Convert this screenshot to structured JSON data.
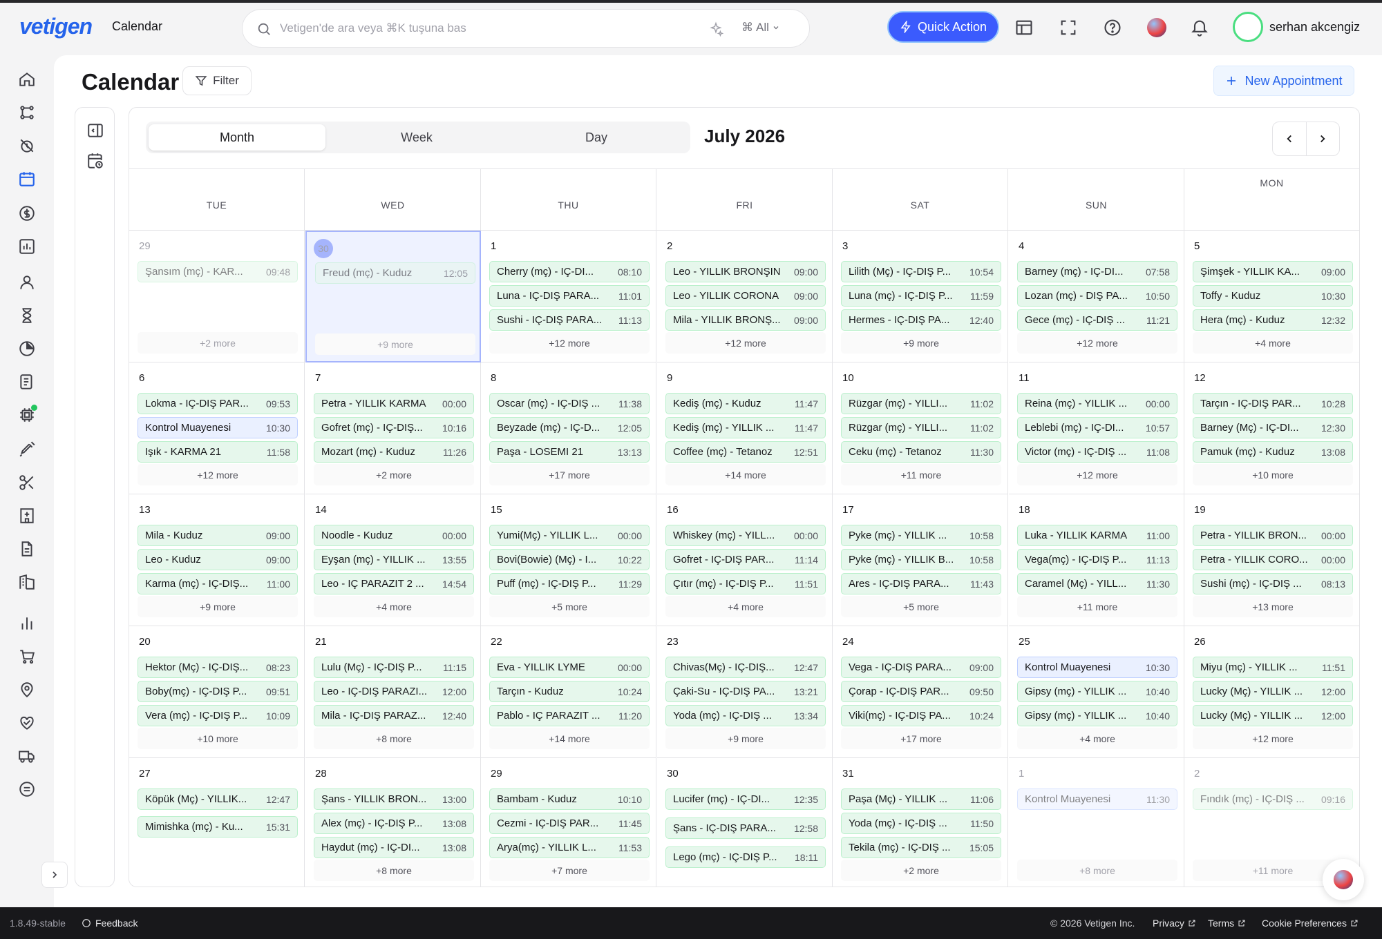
{
  "header": {
    "logo": "vetigen",
    "app_title": "Calendar",
    "search_placeholder": "Vetigen'de ara veya ⌘K tuşuna bas",
    "search_scope": "All",
    "quick_action": "Quick Action",
    "user_name": "serhan akcengiz"
  },
  "page": {
    "title": "Calendar",
    "filter_label": "Filter",
    "new_appointment": "New Appointment"
  },
  "calendar": {
    "views": [
      "Month",
      "Week",
      "Day"
    ],
    "active_view": "Month",
    "month_title": "July 2026",
    "weekdays": [
      "TUE",
      "WED",
      "THU",
      "FRI",
      "SAT",
      "SUN",
      "MON"
    ],
    "weeks": [
      [
        {
          "day": "29",
          "dim": true,
          "events": [
            {
              "t": "Şansım (mç) - KAR...",
              "tm": "09:48"
            }
          ],
          "more": "+2 more"
        },
        {
          "day": "30",
          "dim": true,
          "selected": true,
          "events": [
            {
              "t": "Freud (mç) - Kuduz",
              "tm": "12:05"
            }
          ],
          "more": "+9 more"
        },
        {
          "day": "1",
          "events": [
            {
              "t": "Cherry (mç) - IÇ-DI...",
              "tm": "08:10"
            },
            {
              "t": "Luna - IÇ-DIŞ PARA...",
              "tm": "11:01"
            },
            {
              "t": "Sushi - IÇ-DIŞ PARA...",
              "tm": "11:13"
            }
          ],
          "more": "+12 more"
        },
        {
          "day": "2",
          "events": [
            {
              "t": "Leo - YILLIK BRONŞIN",
              "tm": "09:00"
            },
            {
              "t": "Leo - YILLIK CORONA",
              "tm": "09:00"
            },
            {
              "t": "Mila - YILLIK BRONŞ...",
              "tm": "09:00"
            }
          ],
          "more": "+12 more"
        },
        {
          "day": "3",
          "events": [
            {
              "t": "Lilith (Mç) - IÇ-DIŞ P...",
              "tm": "10:54"
            },
            {
              "t": "Luna (mç) - IÇ-DIŞ P...",
              "tm": "11:59"
            },
            {
              "t": "Hermes - IÇ-DIŞ PA...",
              "tm": "12:40"
            }
          ],
          "more": "+9 more"
        },
        {
          "day": "4",
          "events": [
            {
              "t": "Barney (mç) - IÇ-DI...",
              "tm": "07:58"
            },
            {
              "t": "Lozan (mç) - DIŞ PA...",
              "tm": "10:50"
            },
            {
              "t": "Gece (mç) - IÇ-DIŞ ...",
              "tm": "11:21"
            }
          ],
          "more": "+12 more"
        },
        {
          "day": "5",
          "events": [
            {
              "t": "Şimşek - YILLIK KA...",
              "tm": "09:00"
            },
            {
              "t": "Toffy - Kuduz",
              "tm": "10:30"
            },
            {
              "t": "Hera (mç) - Kuduz",
              "tm": "12:32"
            }
          ],
          "more": "+4 more"
        }
      ],
      [
        {
          "day": "6",
          "events": [
            {
              "t": "Lokma - IÇ-DIŞ PAR...",
              "tm": "09:53"
            },
            {
              "t": "Kontrol Muayenesi",
              "tm": "10:30",
              "control": true
            },
            {
              "t": "Işık - KARMA 21",
              "tm": "11:58"
            }
          ],
          "more": "+12 more"
        },
        {
          "day": "7",
          "events": [
            {
              "t": "Petra - YILLIK KARMA",
              "tm": "00:00"
            },
            {
              "t": "Gofret (mç) - IÇ-DIŞ...",
              "tm": "10:16"
            },
            {
              "t": "Mozart (mç) - Kuduz",
              "tm": "11:26"
            }
          ],
          "more": "+2 more"
        },
        {
          "day": "8",
          "events": [
            {
              "t": "Oscar (mç) - IÇ-DIŞ ...",
              "tm": "11:38"
            },
            {
              "t": "Beyzade (mç) - IÇ-D...",
              "tm": "12:05"
            },
            {
              "t": "Paşa - LOSEMI 21",
              "tm": "13:13"
            }
          ],
          "more": "+17 more"
        },
        {
          "day": "9",
          "events": [
            {
              "t": "Kediş (mç) - Kuduz",
              "tm": "11:47"
            },
            {
              "t": "Kediş (mç) - YILLIK ...",
              "tm": "11:47"
            },
            {
              "t": "Coffee (mç) - Tetanoz",
              "tm": "12:51"
            }
          ],
          "more": "+14 more"
        },
        {
          "day": "10",
          "events": [
            {
              "t": "Rüzgar (mç) - YILLI...",
              "tm": "11:02"
            },
            {
              "t": "Rüzgar (mç) - YILLI...",
              "tm": "11:02"
            },
            {
              "t": "Ceku (mç) - Tetanoz",
              "tm": "11:30"
            }
          ],
          "more": "+11 more"
        },
        {
          "day": "11",
          "events": [
            {
              "t": "Reina (mç) - YILLIK ...",
              "tm": "00:00"
            },
            {
              "t": "Leblebi (mç) - IÇ-DI...",
              "tm": "10:57"
            },
            {
              "t": "Victor (mç) - IÇ-DIŞ ...",
              "tm": "11:08"
            }
          ],
          "more": "+12 more"
        },
        {
          "day": "12",
          "events": [
            {
              "t": "Tarçın - IÇ-DIŞ PAR...",
              "tm": "10:28"
            },
            {
              "t": "Barney (Mç) - IÇ-DI...",
              "tm": "12:30"
            },
            {
              "t": "Pamuk (mç) - Kuduz",
              "tm": "13:08"
            }
          ],
          "more": "+10 more"
        }
      ],
      [
        {
          "day": "13",
          "events": [
            {
              "t": "Mila - Kuduz",
              "tm": "09:00"
            },
            {
              "t": "Leo - Kuduz",
              "tm": "09:00"
            },
            {
              "t": "Karma (mç) - IÇ-DIŞ...",
              "tm": "11:00"
            }
          ],
          "more": "+9 more"
        },
        {
          "day": "14",
          "events": [
            {
              "t": "Noodle - Kuduz",
              "tm": "00:00"
            },
            {
              "t": "Eyşan (mç) - YILLIK ...",
              "tm": "13:55"
            },
            {
              "t": "Leo - IÇ PARAZIT 2 ...",
              "tm": "14:54"
            }
          ],
          "more": "+4 more"
        },
        {
          "day": "15",
          "events": [
            {
              "t": "Yumi(Mç) - YILLIK L...",
              "tm": "00:00"
            },
            {
              "t": "Bovi(Bowie) (Mç) - I...",
              "tm": "10:22"
            },
            {
              "t": "Puff (mç) - IÇ-DIŞ P...",
              "tm": "11:29"
            }
          ],
          "more": "+5 more"
        },
        {
          "day": "16",
          "events": [
            {
              "t": "Whiskey (mç) - YILL...",
              "tm": "00:00"
            },
            {
              "t": "Gofret - IÇ-DIŞ PAR...",
              "tm": "11:14"
            },
            {
              "t": "Çıtır (mç) - IÇ-DIŞ P...",
              "tm": "11:51"
            }
          ],
          "more": "+4 more"
        },
        {
          "day": "17",
          "events": [
            {
              "t": "Pyke (mç) - YILLIK ...",
              "tm": "10:58"
            },
            {
              "t": "Pyke (mç) - YILLIK B...",
              "tm": "10:58"
            },
            {
              "t": "Ares - IÇ-DIŞ PARA...",
              "tm": "11:43"
            }
          ],
          "more": "+5 more"
        },
        {
          "day": "18",
          "events": [
            {
              "t": "Luka - YILLIK KARMA",
              "tm": "11:00"
            },
            {
              "t": "Vega(mç) - IÇ-DIŞ P...",
              "tm": "11:13"
            },
            {
              "t": "Caramel (Mç) - YILL...",
              "tm": "11:30"
            }
          ],
          "more": "+11 more"
        },
        {
          "day": "19",
          "events": [
            {
              "t": "Petra - YILLIK BRON...",
              "tm": "00:00"
            },
            {
              "t": "Petra - YILLIK CORO...",
              "tm": "00:00"
            },
            {
              "t": "Sushi (mç) - IÇ-DIŞ ...",
              "tm": "08:13"
            }
          ],
          "more": "+13 more"
        }
      ],
      [
        {
          "day": "20",
          "events": [
            {
              "t": "Hektor (Mç) - IÇ-DIŞ...",
              "tm": "08:23"
            },
            {
              "t": "Boby(mç) - IÇ-DIŞ P...",
              "tm": "09:51"
            },
            {
              "t": "Vera (mç) - IÇ-DIŞ P...",
              "tm": "10:09"
            }
          ],
          "more": "+10 more"
        },
        {
          "day": "21",
          "events": [
            {
              "t": "Lulu (Mç) - IÇ-DIŞ P...",
              "tm": "11:15"
            },
            {
              "t": "Leo - IÇ-DIŞ PARAZI...",
              "tm": "12:00"
            },
            {
              "t": "Mila - IÇ-DIŞ PARAZ...",
              "tm": "12:40"
            }
          ],
          "more": "+8 more"
        },
        {
          "day": "22",
          "events": [
            {
              "t": "Eva - YILLIK LYME",
              "tm": "00:00"
            },
            {
              "t": "Tarçın - Kuduz",
              "tm": "10:24"
            },
            {
              "t": "Pablo - IÇ PARAZIT ...",
              "tm": "11:20"
            }
          ],
          "more": "+14 more"
        },
        {
          "day": "23",
          "events": [
            {
              "t": "Chivas(Mç) - IÇ-DIŞ...",
              "tm": "12:47"
            },
            {
              "t": "Çaki-Su - IÇ-DIŞ PA...",
              "tm": "13:21"
            },
            {
              "t": "Yoda (mç) - IÇ-DIŞ ...",
              "tm": "13:34"
            }
          ],
          "more": "+9 more"
        },
        {
          "day": "24",
          "events": [
            {
              "t": "Vega - IÇ-DIŞ PARA...",
              "tm": "09:00"
            },
            {
              "t": "Çorap - IÇ-DIŞ PAR...",
              "tm": "09:50"
            },
            {
              "t": "Viki(mç) - IÇ-DIŞ PA...",
              "tm": "10:24"
            }
          ],
          "more": "+17 more"
        },
        {
          "day": "25",
          "events": [
            {
              "t": "Kontrol Muayenesi",
              "tm": "10:30",
              "control": true
            },
            {
              "t": "Gipsy (mç) - YILLIK ...",
              "tm": "10:40"
            },
            {
              "t": "Gipsy (mç) - YILLIK ...",
              "tm": "10:40"
            }
          ],
          "more": "+4 more"
        },
        {
          "day": "26",
          "events": [
            {
              "t": "Miyu (mç) - YILLIK ...",
              "tm": "11:51"
            },
            {
              "t": "Lucky (Mç) - YILLIK ...",
              "tm": "12:00"
            },
            {
              "t": "Lucky (Mç) - YILLIK ...",
              "tm": "12:00"
            }
          ],
          "more": "+12 more"
        }
      ],
      [
        {
          "day": "27",
          "events": [
            {
              "t": "Köpük (Mç) - YILLIK...",
              "tm": "12:47"
            },
            {
              "t": "Mimishka (mç) - Ku...",
              "tm": "15:31"
            }
          ],
          "more": ""
        },
        {
          "day": "28",
          "events": [
            {
              "t": "Şans - YILLIK BRON...",
              "tm": "13:00"
            },
            {
              "t": "Alex (mç) - IÇ-DIŞ P...",
              "tm": "13:08"
            },
            {
              "t": "Haydut (mç) - IÇ-DI...",
              "tm": "13:08"
            }
          ],
          "more": "+8 more"
        },
        {
          "day": "29",
          "events": [
            {
              "t": "Bambam - Kuduz",
              "tm": "10:10"
            },
            {
              "t": "Cezmi - IÇ-DIŞ PAR...",
              "tm": "11:45"
            },
            {
              "t": "Arya(mç) - YILLIK L...",
              "tm": "11:53"
            }
          ],
          "more": "+7 more"
        },
        {
          "day": "30",
          "events": [
            {
              "t": "Lucifer (mç) - IÇ-DI...",
              "tm": "12:35"
            },
            {
              "t": "Şans - IÇ-DIŞ PARA...",
              "tm": "12:58"
            },
            {
              "t": "Lego (mç) - IÇ-DIŞ P...",
              "tm": "18:11"
            }
          ],
          "more": ""
        },
        {
          "day": "31",
          "events": [
            {
              "t": "Paşa (Mç) - YILLIK ...",
              "tm": "11:06"
            },
            {
              "t": "Yoda (mç) - IÇ-DIŞ ...",
              "tm": "11:50"
            },
            {
              "t": "Tekila (mç) - IÇ-DIŞ ...",
              "tm": "15:05"
            }
          ],
          "more": "+2 more"
        },
        {
          "day": "1",
          "dim": true,
          "events": [
            {
              "t": "Kontrol Muayenesi",
              "tm": "11:30",
              "control": true
            }
          ],
          "more": "+8 more"
        },
        {
          "day": "2",
          "dim": true,
          "events": [
            {
              "t": "Fındık (mç) - IÇ-DIŞ ...",
              "tm": "09:16"
            }
          ],
          "more": "+11 more"
        }
      ]
    ]
  },
  "footer": {
    "version": "1.8.49-stable",
    "feedback": "Feedback",
    "copyright": "© 2026 Vetigen Inc.",
    "privacy": "Privacy",
    "terms": "Terms",
    "cookies": "Cookie Preferences"
  },
  "colors": {
    "accent": "#3b5bfd",
    "event_bg": "#e6f7ec",
    "control_bg": "#eaf0ff",
    "selected_day": "#a5b4fc"
  }
}
